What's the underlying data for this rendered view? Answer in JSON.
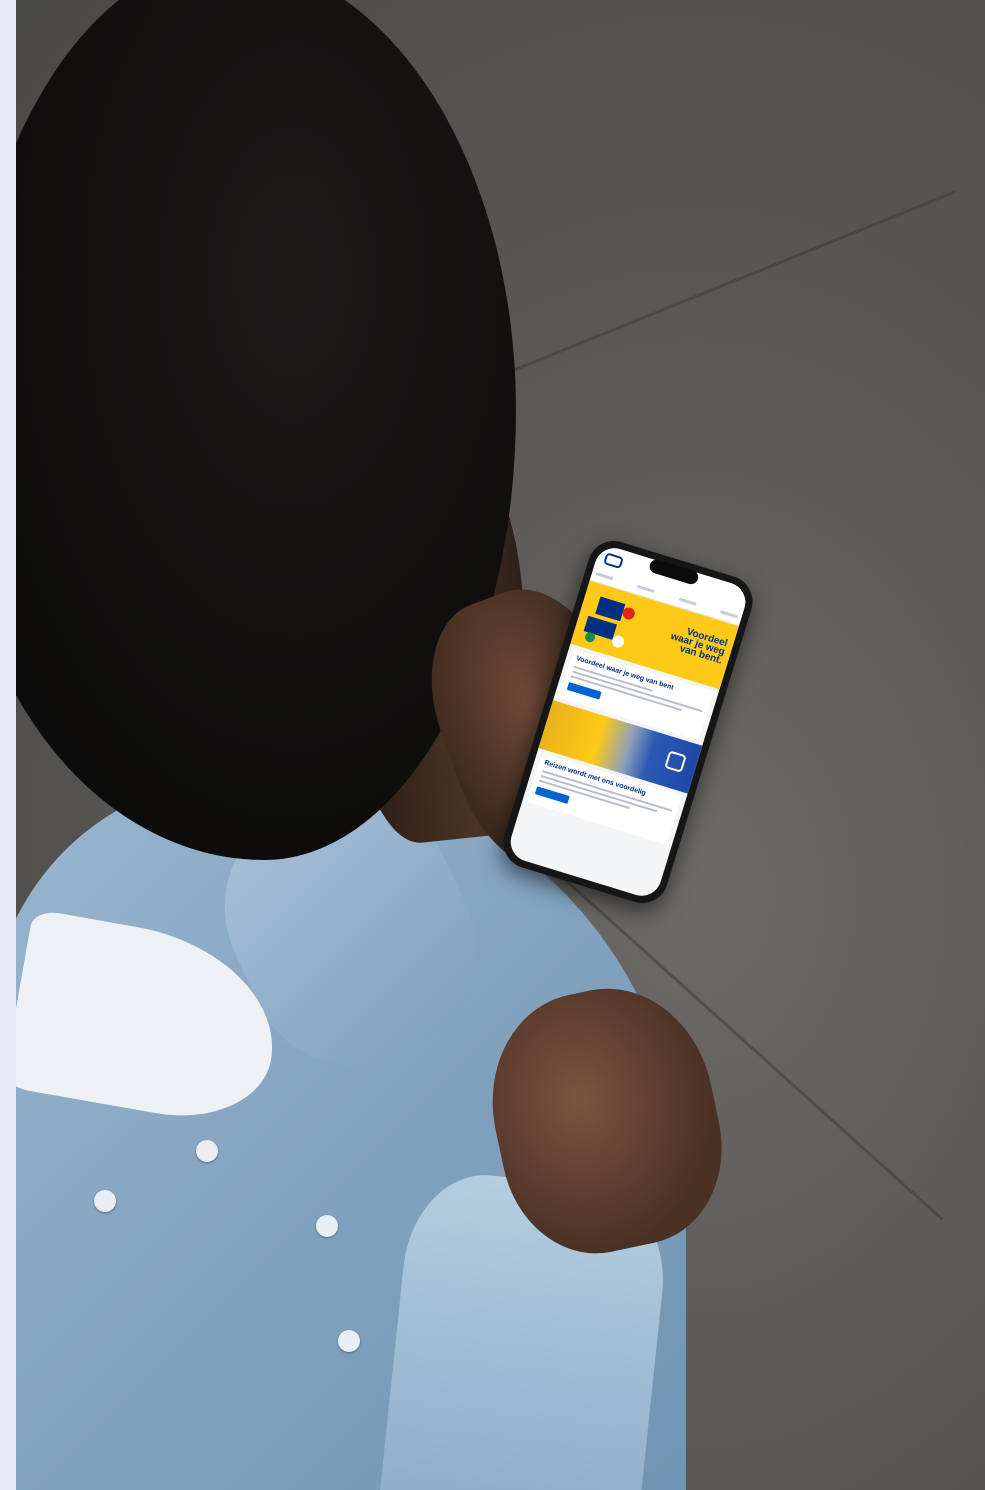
{
  "scene": {
    "description_tags": [
      "person",
      "smartphone",
      "concrete-floor",
      "denim-shirt"
    ]
  },
  "phone_screen": {
    "banner_headline": "Voordeel waar je weg van bent.",
    "card1_title": "Voordeel waar je weg van bent",
    "card2_title": "Reizen wordt met ons voordelig"
  },
  "colors": {
    "ns_yellow": "#ffc917",
    "ns_blue": "#003082",
    "button_blue": "#0063d3",
    "background_strip": "#e6ebf7"
  }
}
